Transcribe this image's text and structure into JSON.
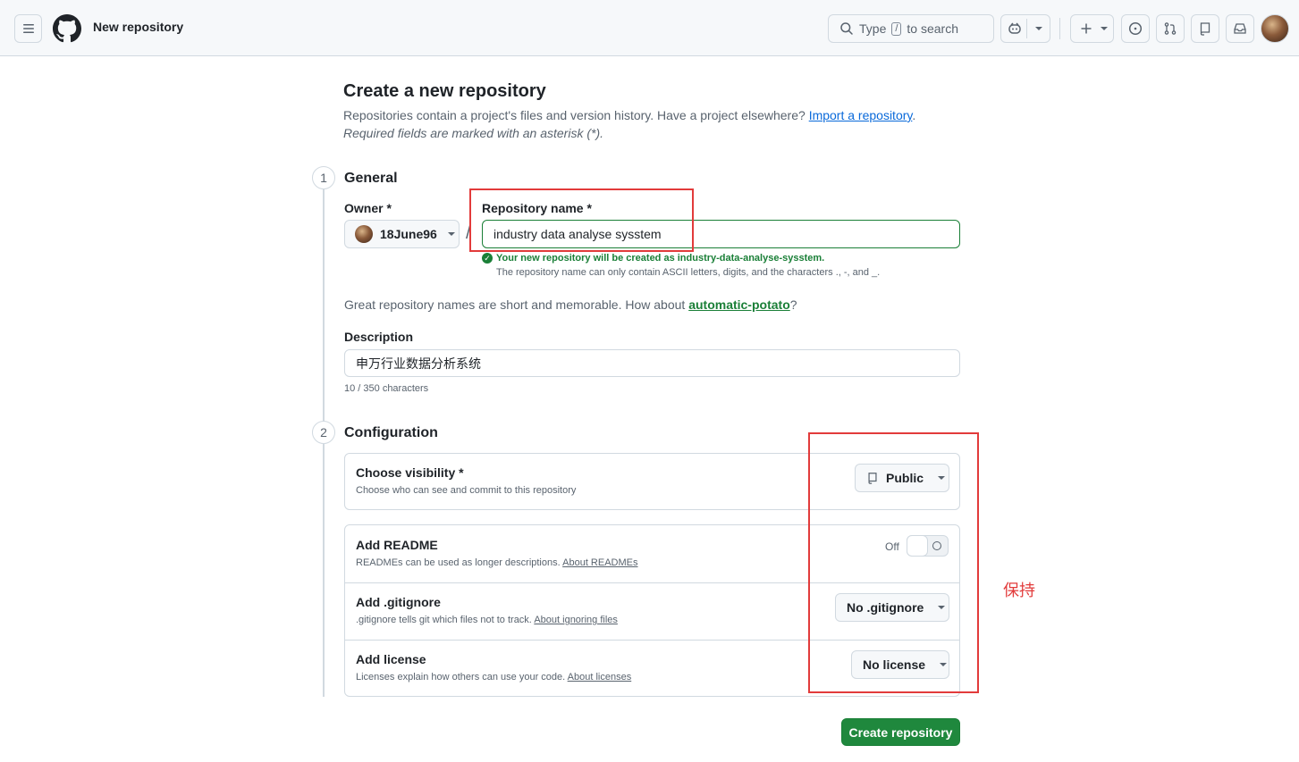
{
  "header": {
    "context_title": "New repository",
    "search_prefix": "Type",
    "search_key": "/",
    "search_suffix": "to search"
  },
  "page": {
    "title": "Create a new repository",
    "subtitle_text": "Repositories contain a project's files and version history. Have a project elsewhere?",
    "import_link": "Import a repository",
    "subtitle_end": ".",
    "required_note": "Required fields are marked with an asterisk (*)."
  },
  "general": {
    "step": "1",
    "title": "General",
    "owner_label": "Owner *",
    "owner_value": "18June96",
    "separator": "/",
    "repo_label": "Repository name *",
    "repo_value": "industry data analyse sysstem",
    "valid_message": "Your new repository will be created as industry-data-analyse-sysstem.",
    "hint_message": "The repository name can only contain ASCII letters, digits, and the characters ., -, and _.",
    "suggestion_prefix": "Great repository names are short and memorable. How about",
    "suggestion_name": "automatic-potato",
    "suggestion_suffix": "?",
    "description_label": "Description",
    "description_value": "申万行业数据分析系统",
    "char_count": "10 / 350 characters"
  },
  "configuration": {
    "step": "2",
    "title": "Configuration",
    "visibility_title": "Choose visibility *",
    "visibility_desc": "Choose who can see and commit to this repository",
    "visibility_value": "Public",
    "readme_title": "Add README",
    "readme_desc": "READMEs can be used as longer descriptions.",
    "readme_link": "About READMEs",
    "readme_toggle_label": "Off",
    "readme_enabled": false,
    "gitignore_title": "Add .gitignore",
    "gitignore_desc": ".gitignore tells git which files not to track.",
    "gitignore_link": "About ignoring files",
    "gitignore_value": "No .gitignore",
    "license_title": "Add license",
    "license_desc": "Licenses explain how others can use your code.",
    "license_link": "About licenses",
    "license_value": "No license"
  },
  "actions": {
    "create_label": "Create repository"
  },
  "annotation": {
    "text": "保持",
    "color": "#e23b3b"
  },
  "colors": {
    "primary_button": "#1f883d",
    "success": "#1a7f37",
    "link": "#0969da"
  }
}
